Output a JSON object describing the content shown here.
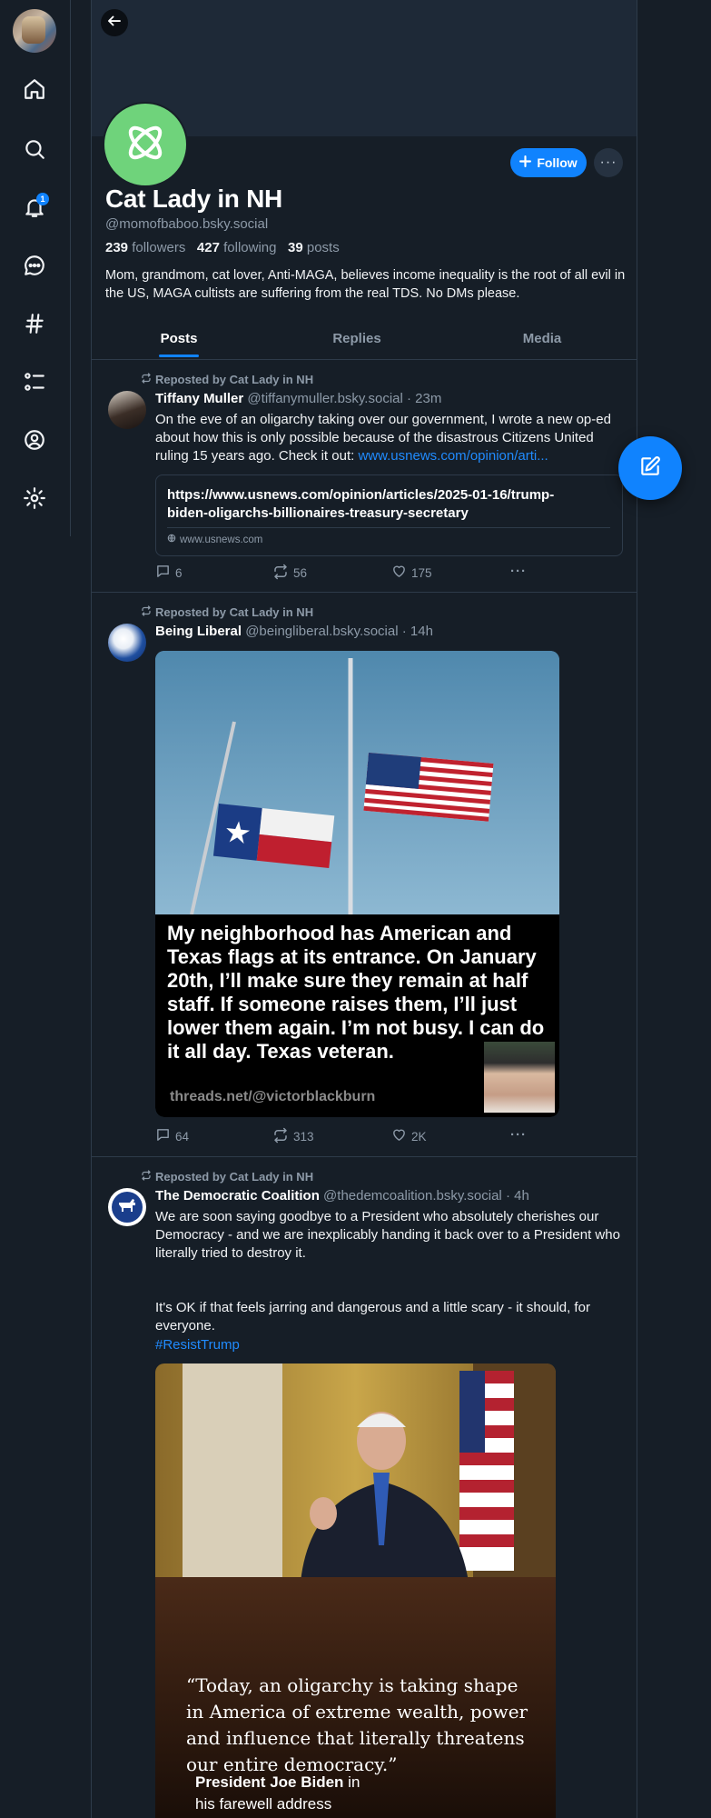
{
  "profile": {
    "display_name": "Cat Lady in NH",
    "handle": "@momofbaboo.bsky.social",
    "followers_count": "239",
    "followers_label": "followers",
    "following_count": "427",
    "following_label": "following",
    "posts_count": "39",
    "posts_label": "posts",
    "bio": "Mom, grandmom, cat lover, Anti-MAGA, believes income inequality is the root of all evil in the US, MAGA cultists are suffering from the real TDS.  No DMs please.",
    "follow_label": "Follow",
    "avatar_color": "#6fd37b"
  },
  "nav": {
    "notifications_badge": "1",
    "items": [
      "home-icon",
      "search-icon",
      "bell-icon",
      "chat-icon",
      "hash-icon",
      "list-icon",
      "profile-icon",
      "settings-icon"
    ]
  },
  "tabs": [
    "Posts",
    "Replies",
    "Media"
  ],
  "posts": [
    {
      "repost_label": "Reposted by Cat Lady in NH",
      "author_name": "Tiffany Muller",
      "author_handle": "@tiffanymuller.bsky.social",
      "time": "· 23m",
      "text": "On the eve of an oligarchy taking over our government, I wrote a new op-ed about how this is only possible because of the disastrous Citizens United ruling 15 years ago. Check it out: ",
      "link_text": "www.usnews.com/opinion/arti...",
      "embed_title": "https://www.usnews.com/opinion/articles/2025-01-16/trump-biden-oligarchs-billionaires-treasury-secretary",
      "embed_domain": "www.usnews.com",
      "replies": "6",
      "reposts": "56",
      "likes": "175"
    },
    {
      "repost_label": "Reposted by Cat Lady in NH",
      "author_name": "Being Liberal",
      "author_handle": "@beingliberal.bsky.social",
      "time": "· 14h",
      "image_caption": "My neighborhood has American and Texas flags at its entrance. On January 20th, I’ll make sure they remain at half staff. If someone raises them, I’ll just lower them again. I’m not busy. I can do it all day. Texas veteran.",
      "image_credit": "threads.net/@victorblackburn",
      "replies": "64",
      "reposts": "313",
      "likes": "2K"
    },
    {
      "repost_label": "Reposted by Cat Lady in NH",
      "author_name": "The Democratic Coalition",
      "author_handle": "@thedemcoalition.bsky.social",
      "time": "· 4h",
      "text_p1": "We are soon saying goodbye to a President who absolutely cherishes our Democracy - and we are inexplicably handing it back over to a President who literally tried to destroy it.",
      "text_p2": "It's OK if that feels jarring and dangerous and a little scary - it should, for everyone.",
      "hashtag": "#ResistTrump",
      "image_quote": "“Today, an oligarchy is taking shape in America of extreme wealth, power and influence that literally threatens our entire democracy.”",
      "image_quote_author": "President Joe Biden",
      "image_quote_in": " in",
      "image_quote_source": "his farewell address"
    }
  ]
}
